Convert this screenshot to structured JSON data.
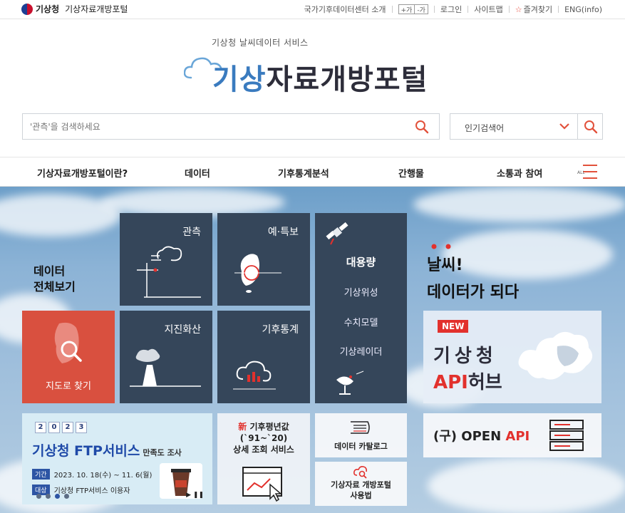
{
  "topbar": {
    "org": "기상청",
    "site": "기상자료개방포털",
    "links": {
      "intro": "국가기후데이터센터 소개",
      "font_up": "+가",
      "font_down": "-가",
      "login": "로그인",
      "sitemap": "사이트맵",
      "favorites": "즐겨찾기",
      "english": "ENG(info)"
    }
  },
  "header": {
    "tagline": "기상청 날씨데이터 서비스",
    "logo_accent": "기상",
    "logo_rest": "자료개방포털",
    "search_placeholder": "'관측'을 검색하세요",
    "popular_label": "인기검색어"
  },
  "nav": {
    "items": [
      "기상자료개방포털이란?",
      "데이터",
      "기후통계분석",
      "간행물",
      "소통과 참여"
    ],
    "all_label": "ALL"
  },
  "hero": {
    "data_all_line1": "데이터",
    "data_all_line2": "전체보기",
    "map_label": "지도로 찾기",
    "tiles": {
      "observation": "관측",
      "forecast": "예·특보",
      "earthquake": "지진화산",
      "climate": "기후통계"
    },
    "bigdata": {
      "title": "대용량",
      "items": [
        "기상위성",
        "수치모델",
        "기상레이더"
      ]
    },
    "slogan_line1": "날씨!",
    "slogan_line2": "데이터가 되다",
    "api_hub": {
      "badge": "NEW",
      "line1": "기상청",
      "line2_accent": "API",
      "line2_rest": "허브"
    },
    "ftp_banner": {
      "year_cards": [
        "2",
        "0",
        "2",
        "3"
      ],
      "title": "기상청 FTP서비스",
      "subtitle": "만족도 조사",
      "period_tag": "기간",
      "period": "2023. 10. 18(수) ~ 11. 6(월)",
      "target_tag": "대상",
      "target": "기상청 FTP서비스 이용자",
      "controls": "▶ ❚❚"
    },
    "normals": {
      "badge": "新",
      "line1": "기후평년값",
      "line2": "(`91~`20)",
      "line3": "상세 조회 서비스"
    },
    "catalog": "데이터 카탈로그",
    "usage_line1": "기상자료 개방포털",
    "usage_line2": "사용법",
    "openapi": {
      "prefix": "(구) OPEN ",
      "accent": "API"
    }
  },
  "colors": {
    "accent_red": "#e2312d",
    "tile_navy": "#35465a",
    "brand_blue": "#3a7bbf"
  }
}
